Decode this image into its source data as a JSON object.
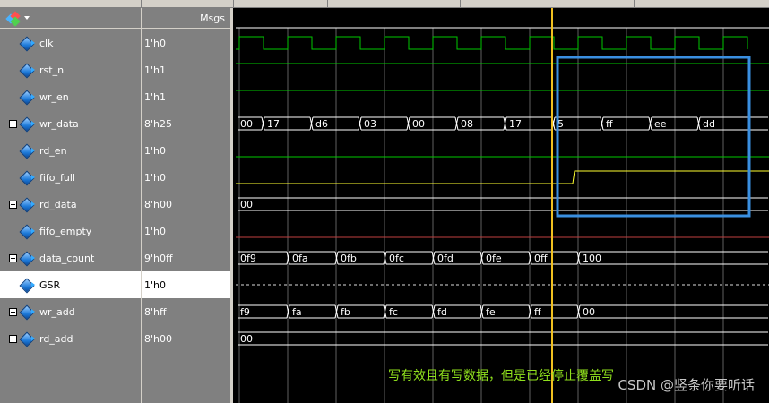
{
  "header": {
    "msgs_label": "Msgs"
  },
  "signals": [
    {
      "name": "clk",
      "value": "1'h0",
      "bus": false
    },
    {
      "name": "rst_n",
      "value": "1'h1",
      "bus": false
    },
    {
      "name": "wr_en",
      "value": "1'h1",
      "bus": false
    },
    {
      "name": "wr_data",
      "value": "8'h25",
      "bus": true
    },
    {
      "name": "rd_en",
      "value": "1'h0",
      "bus": false
    },
    {
      "name": "fifo_full",
      "value": "1'h0",
      "bus": false
    },
    {
      "name": "rd_data",
      "value": "8'h00",
      "bus": true
    },
    {
      "name": "fifo_empty",
      "value": "1'h0",
      "bus": false
    },
    {
      "name": "data_count",
      "value": "9'h0ff",
      "bus": true
    },
    {
      "name": "GSR",
      "value": "1'h0",
      "bus": false,
      "selected": true
    },
    {
      "name": "wr_add",
      "value": "8'hff",
      "bus": true
    },
    {
      "name": "rd_add",
      "value": "8'h00",
      "bus": true
    }
  ],
  "bus_values": {
    "wr_data": [
      "00",
      "17",
      "d6",
      "03",
      "00",
      "08",
      "17",
      "5",
      "ff",
      "ee",
      "dd"
    ],
    "rd_data": [
      "00"
    ],
    "data_count": [
      "0f9",
      "0fa",
      "0fb",
      "0fc",
      "0fd",
      "0fe",
      "0ff",
      "100"
    ],
    "wr_add": [
      "f9",
      "fa",
      "fb",
      "fc",
      "fd",
      "fe",
      "ff",
      "00"
    ],
    "rd_add": [
      "00"
    ]
  },
  "annotation": "写有效且有写数据，但是已经停止覆盖写",
  "watermark": "CSDN @竖条你要听话",
  "colors": {
    "green": "#00c800",
    "yellow": "#ffff30",
    "cursor": "#f0c020",
    "highlight": "#3a8fe0",
    "red": "#c04040"
  }
}
